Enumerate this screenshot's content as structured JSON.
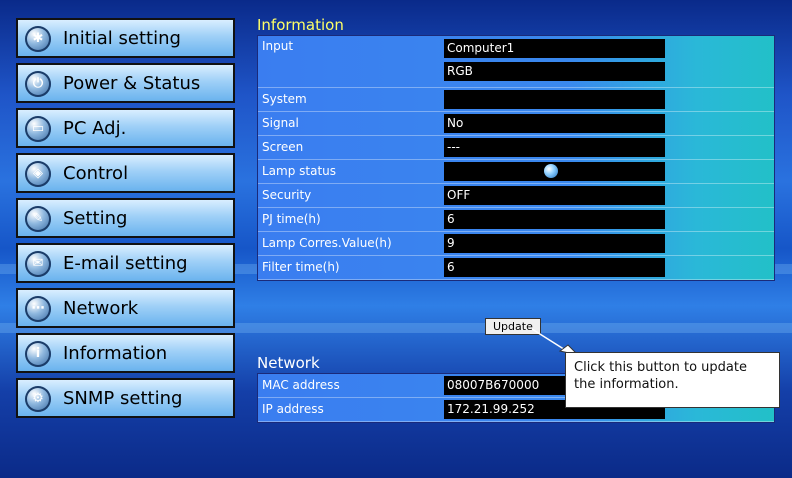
{
  "sidebar": {
    "items": [
      {
        "label": "Initial setting",
        "icon": "gear-icon"
      },
      {
        "label": "Power & Status",
        "icon": "power-icon"
      },
      {
        "label": "PC Adj.",
        "icon": "monitor-icon"
      },
      {
        "label": "Control",
        "icon": "control-icon"
      },
      {
        "label": "Setting",
        "icon": "wrench-icon"
      },
      {
        "label": "E-mail setting",
        "icon": "envelope-icon"
      },
      {
        "label": "Network",
        "icon": "network-icon"
      },
      {
        "label": "Information",
        "icon": "info-icon"
      },
      {
        "label": "SNMP setting",
        "icon": "snmp-icon"
      }
    ]
  },
  "information": {
    "title": "Information",
    "input_label": "Input",
    "input_value1": "Computer1",
    "input_value2": "RGB",
    "rows": [
      {
        "label": "System",
        "value": ""
      },
      {
        "label": "Signal",
        "value": "No"
      },
      {
        "label": "Screen",
        "value": "---"
      },
      {
        "label": "Lamp status",
        "value": ""
      },
      {
        "label": "Security",
        "value": "OFF"
      },
      {
        "label": "PJ time(h)",
        "value": "6"
      },
      {
        "label": "Lamp Corres.Value(h)",
        "value": "9"
      },
      {
        "label": "Filter time(h)",
        "value": "6"
      }
    ],
    "update_button": "Update"
  },
  "network": {
    "title": "Network",
    "rows": [
      {
        "label": "MAC address",
        "value": "08007B670000"
      },
      {
        "label": "IP address",
        "value": "172.21.99.252"
      }
    ]
  },
  "callout": {
    "text": "Click this button to update the information."
  },
  "colors": {
    "title_yellow": "#ffff66",
    "value_bg": "#000000",
    "panel_blue": "#3a7df0",
    "panel_cyan": "#22c0c8"
  }
}
